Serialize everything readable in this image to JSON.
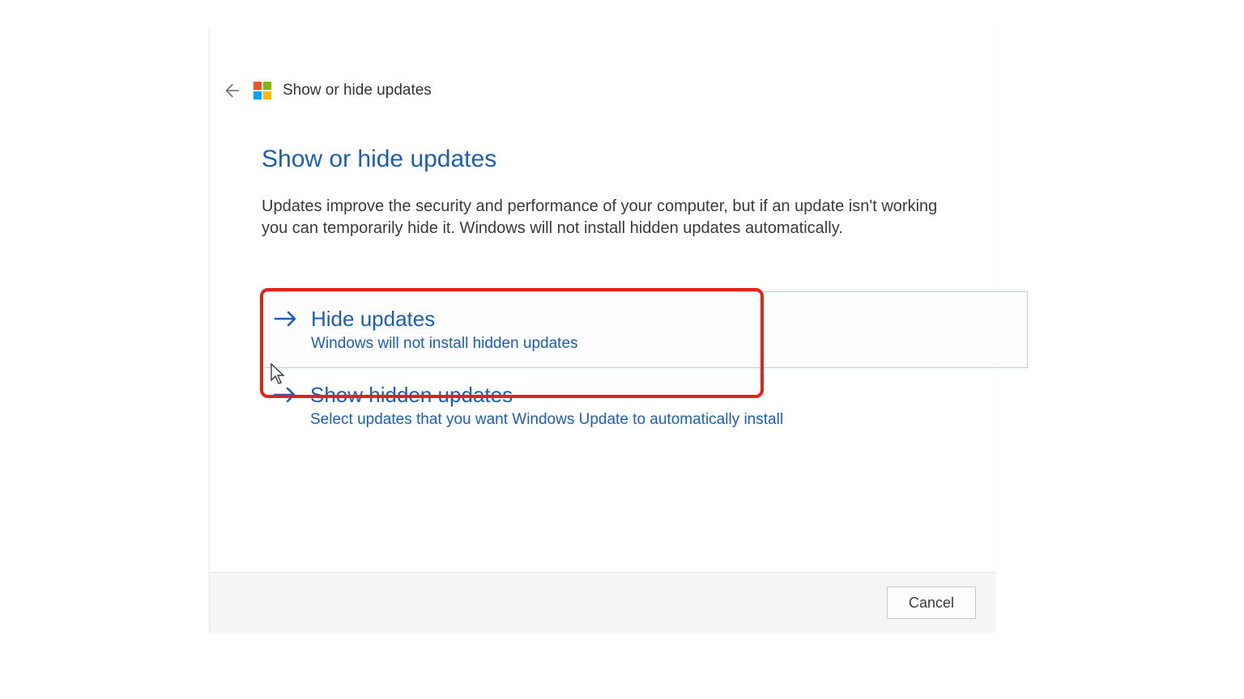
{
  "header": {
    "title": "Show or hide updates"
  },
  "main": {
    "heading": "Show or hide updates",
    "description": "Updates improve the security and performance of your computer, but if an update isn't working you can temporarily hide it. Windows will not install hidden updates automatically."
  },
  "options": [
    {
      "title": "Hide updates",
      "subtitle": "Windows will not install hidden updates",
      "highlighted": true
    },
    {
      "title": "Show hidden updates",
      "subtitle": "Select updates that you want Windows Update to automatically install",
      "highlighted": false
    }
  ],
  "footer": {
    "cancel_label": "Cancel"
  },
  "colors": {
    "link": "#1a5fb4",
    "highlight_border": "#e2231a"
  }
}
